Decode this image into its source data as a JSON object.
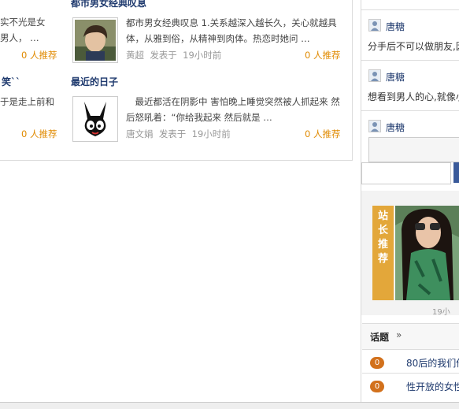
{
  "left_partial": {
    "item1_line1": "实不光是女",
    "item1_line2": "男人， …",
    "item1_rec": "0 人推荐",
    "item2_title": "笑``",
    "item2_line1": "于是走上前和",
    "item2_rec": "0 人推荐"
  },
  "posts": [
    {
      "title": "都市男女经典叹息",
      "excerpt": "都市男女经典叹息 1.关系越深入越长久，关心就越具体，从雅到俗，从精神到肉体。热恋时她问 …",
      "author": "黄超",
      "posted_label": "发表于",
      "time": "19小时前",
      "recommend": "0 人推荐"
    },
    {
      "title": "最近的日子",
      "excerpt": "　最近都活在阴影中 害怕晚上睡觉突然被人抓起来 然后怒吼着：“你给我起来 然后就是 …",
      "author": "唐文娟",
      "posted_label": "发表于",
      "time": "19小时前",
      "recommend": "0 人推荐"
    }
  ],
  "comments": [
    {
      "user": "唐糖",
      "text": "分手后不可以做朋友,因"
    },
    {
      "user": "唐糖",
      "text": "想看到男人的心,就像小"
    },
    {
      "user": "唐糖",
      "text": ""
    }
  ],
  "promo": {
    "label_chars": [
      "站",
      "长",
      "推",
      "荐"
    ],
    "caption": "19小"
  },
  "topics": {
    "header": "话题",
    "more_glyph": "»",
    "items": [
      {
        "count": "0",
        "title": "80后的我们他"
      },
      {
        "count": "0",
        "title": "性开放的女性"
      }
    ]
  },
  "colors": {
    "link": "#1f3a6e",
    "recommend": "#e08a00",
    "badge": "#d2711c",
    "promo_label": "#e3a73a"
  }
}
